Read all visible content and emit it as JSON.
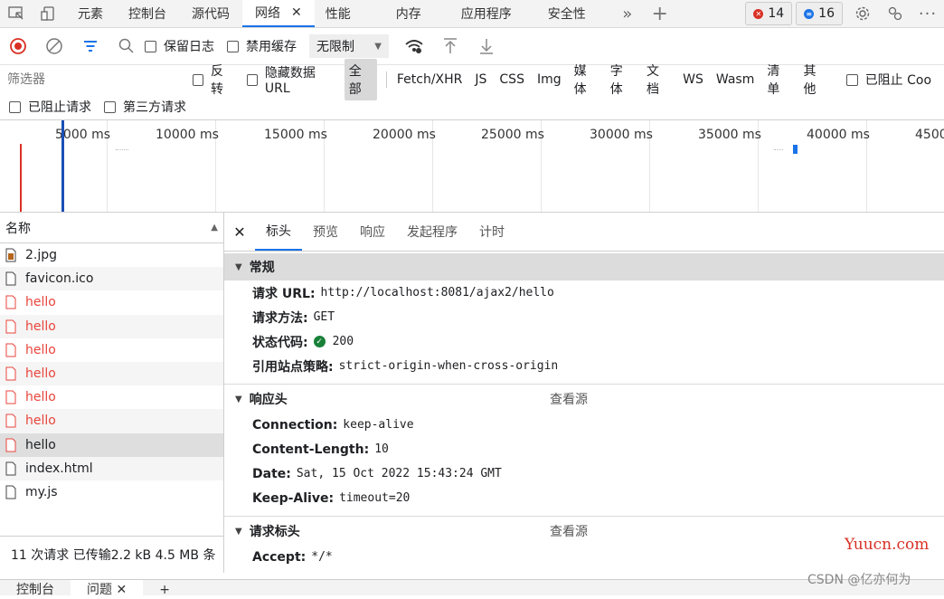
{
  "tabs": [
    {
      "label": "元素"
    },
    {
      "label": "控制台"
    },
    {
      "label": "源代码"
    },
    {
      "label": "网络",
      "active": true
    },
    {
      "label": "性能"
    },
    {
      "label": "内存"
    },
    {
      "label": "应用程序"
    },
    {
      "label": "安全性"
    }
  ],
  "badges": {
    "errors": "14",
    "messages": "16"
  },
  "toolbar": {
    "preserve_log": "保留日志",
    "disable_cache": "禁用缓存",
    "throttle": "无限制"
  },
  "filter": {
    "placeholder": "筛选器",
    "invert": "反转",
    "hide_data_urls": "隐藏数据 URL",
    "types": [
      "全部",
      "Fetch/XHR",
      "JS",
      "CSS",
      "Img",
      "媒体",
      "字体",
      "文档",
      "WS",
      "Wasm",
      "清单",
      "其他"
    ],
    "blocked_cookies": "已阻止 Coo",
    "blocked_requests": "已阻止请求",
    "third_party": "第三方请求"
  },
  "timeline": {
    "ticks": [
      "5000 ms",
      "10000 ms",
      "15000 ms",
      "20000 ms",
      "25000 ms",
      "30000 ms",
      "35000 ms",
      "40000 ms",
      "4500"
    ]
  },
  "list": {
    "header": "名称",
    "items": [
      {
        "name": "2.jpg",
        "type": "img"
      },
      {
        "name": "favicon.ico",
        "type": "doc"
      },
      {
        "name": "hello",
        "type": "err"
      },
      {
        "name": "hello",
        "type": "err"
      },
      {
        "name": "hello",
        "type": "err"
      },
      {
        "name": "hello",
        "type": "err"
      },
      {
        "name": "hello",
        "type": "err"
      },
      {
        "name": "hello",
        "type": "err"
      },
      {
        "name": "hello",
        "type": "selected"
      },
      {
        "name": "index.html",
        "type": "doc"
      },
      {
        "name": "my.js",
        "type": "doc"
      }
    ],
    "summary": "11 次请求  已传输2.2 kB  4.5 MB 条"
  },
  "details": {
    "tabs": [
      "标头",
      "预览",
      "响应",
      "发起程序",
      "计时"
    ],
    "general": {
      "title": "常规",
      "rows": [
        {
          "k": "请求 URL:",
          "v": "http://localhost:8081/ajax2/hello"
        },
        {
          "k": "请求方法:",
          "v": "GET"
        },
        {
          "k": "状态代码:",
          "v": "200"
        },
        {
          "k": "引用站点策略:",
          "v": "strict-origin-when-cross-origin"
        }
      ]
    },
    "response_headers": {
      "title": "响应头",
      "view_source": "查看源",
      "rows": [
        {
          "k": "Connection:",
          "v": "keep-alive"
        },
        {
          "k": "Content-Length:",
          "v": "10"
        },
        {
          "k": "Date:",
          "v": "Sat, 15 Oct 2022 15:43:24 GMT"
        },
        {
          "k": "Keep-Alive:",
          "v": "timeout=20"
        }
      ]
    },
    "request_headers": {
      "title": "请求标头",
      "view_source": "查看源",
      "rows": [
        {
          "k": "Accept:",
          "v": "*/*"
        }
      ]
    }
  },
  "drawer": {
    "tabs": [
      "控制台",
      "问题"
    ]
  },
  "watermarks": {
    "site": "Yuucn.com",
    "csdn": "CSDN @亿亦何为"
  },
  "colors": {
    "accent": "#1a73e8",
    "error": "#e8453c",
    "record": "#d93025",
    "ok": "#188038"
  }
}
